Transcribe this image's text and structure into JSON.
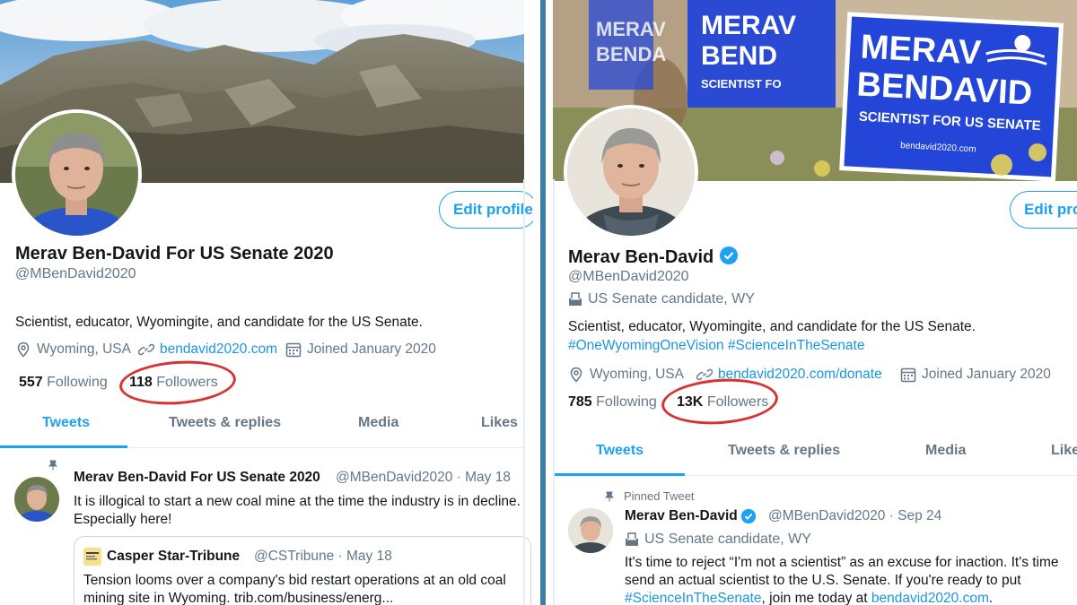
{
  "colors": {
    "accent": "#1da1f2",
    "link": "#1b95e0",
    "annotation": "#d63333",
    "divider": "#3e7fa6"
  },
  "left": {
    "edit_button": "Edit profile",
    "display_name": "Merav Ben-David For US Senate 2020",
    "handle": "@MBenDavid2020",
    "bio": "Scientist, educator, Wyomingite, and candidate for the US Senate.",
    "location": "Wyoming, USA",
    "website": "bendavid2020.com",
    "joined": "Joined January 2020",
    "following_count": "557",
    "following_label": "Following",
    "followers_count": "118",
    "followers_label": "Followers",
    "tabs": [
      "Tweets",
      "Tweets & replies",
      "Media",
      "Likes"
    ],
    "tweet": {
      "name": "Merav Ben-David For US Senate 2020",
      "handle_date": "@MBenDavid2020 · May 18",
      "line1": "It is illogical to start a new coal mine at the time the industry is in decline.",
      "line2": "Especially here!",
      "quote": {
        "name": "Casper Star-Tribune",
        "handle_date": "@CSTribune · May 18",
        "line1": "Tension looms over a company's bid restart operations at an old coal",
        "line2": "mining site in Wyoming. trib.com/business/energ..."
      }
    }
  },
  "right": {
    "banner_sign_line1": "MERAV",
    "banner_sign_line2": "BENDAVID",
    "banner_sign_line3": "SCIENTIST FOR US SENATE",
    "banner_sign_line4": "bendavid2020.com",
    "banner_sign_bg_1": "MERAV",
    "banner_sign_bg_2": "BEND",
    "banner_sign_bg_3": "SCIENTIST FO",
    "banner_sign_bg_4": "MERAV",
    "banner_sign_bg_5": "BENDA",
    "edit_button": "Edit pro",
    "display_name": "Merav Ben-David",
    "handle": "@MBenDavid2020",
    "label": "US Senate candidate, WY",
    "bio": "Scientist, educator, Wyomingite, and candidate for the US Senate.",
    "hashtags": "#OneWyomingOneVision #ScienceInTheSenate",
    "location": "Wyoming, USA",
    "website": "bendavid2020.com/donate",
    "joined": "Joined January 2020",
    "following_count": "785",
    "following_label": "Following",
    "followers_count": "13K",
    "followers_label": "Followers",
    "tabs": [
      "Tweets",
      "Tweets & replies",
      "Media",
      "Like"
    ],
    "tweet": {
      "pinned": "Pinned Tweet",
      "name": "Merav Ben-David",
      "handle_date": "@MBenDavid2020 · Sep 24",
      "label": "US Senate candidate, WY",
      "line1": "It's time to reject “I'm not a scientist” as an excuse for inaction. It's time",
      "line2": "send an actual scientist to the U.S. Senate. If you're ready to put",
      "line3_tag": "#ScienceInTheSenate",
      "line3_mid": ", join me today at ",
      "line3_link": "bendavid2020.com",
      "line3_end": "."
    }
  }
}
